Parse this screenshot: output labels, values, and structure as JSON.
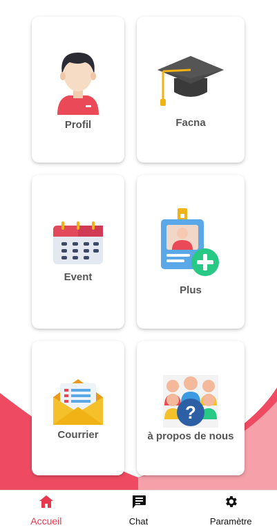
{
  "tiles": [
    {
      "label": "Profil",
      "icon": "profile-avatar-icon"
    },
    {
      "label": "Facna",
      "icon": "graduation-cap-icon"
    },
    {
      "label": "Event",
      "icon": "calendar-icon"
    },
    {
      "label": "Plus",
      "icon": "id-badge-add-icon"
    },
    {
      "label": "Courrier",
      "icon": "mail-envelope-icon"
    },
    {
      "label": "à propos de nous",
      "icon": "group-question-icon"
    }
  ],
  "nav": {
    "items": [
      {
        "label": "Accueil",
        "icon": "home-icon",
        "active": true
      },
      {
        "label": "Chat",
        "icon": "chat-icon",
        "active": false
      },
      {
        "label": "Paramètre",
        "icon": "gear-icon",
        "active": false
      }
    ]
  },
  "colors": {
    "accent": "#e8384f",
    "background_wave": "#ee4b62",
    "background_wave_light": "#f59aa4",
    "card": "#ffffff",
    "label_text": "#555555"
  }
}
